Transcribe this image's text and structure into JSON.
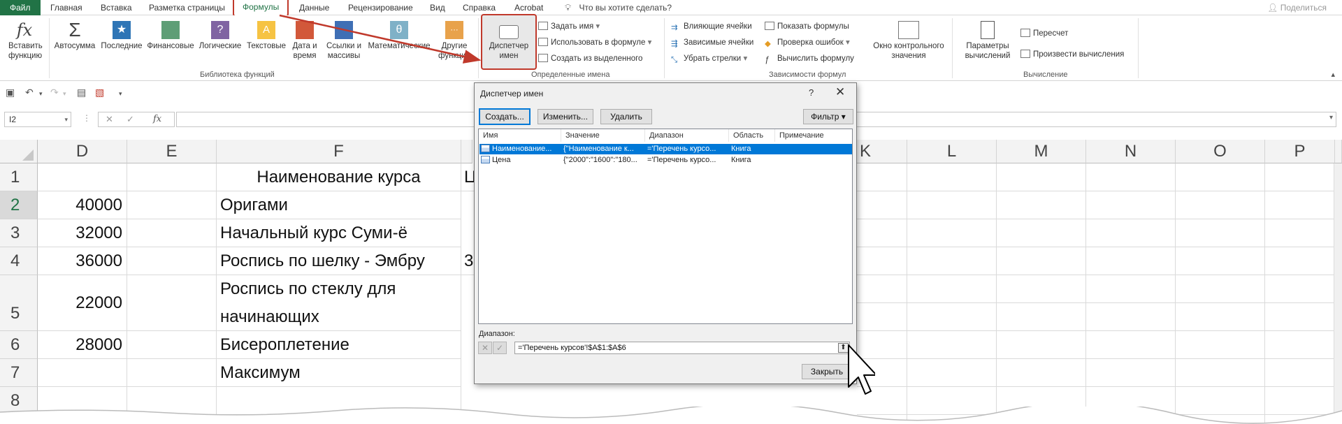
{
  "menu": {
    "tabs": [
      "Файл",
      "Главная",
      "Вставка",
      "Разметка страницы",
      "Формулы",
      "Данные",
      "Рецензирование",
      "Вид",
      "Справка",
      "Acrobat"
    ],
    "search": "Что вы хотите сделать?",
    "share": "Поделиться"
  },
  "ribbon": {
    "insert_function": "Вставить функцию",
    "autosum": "Автосумма",
    "recent": "Последние",
    "financial": "Финансовые",
    "logical": "Логические",
    "text": "Текстовые",
    "datetime": "Дата и время",
    "lookup": "Ссылки и массивы",
    "math": "Математические",
    "other": "Другие функции",
    "group_library": "Библиотека функций",
    "name_manager": "Диспетчер имен",
    "define_name": "Задать имя",
    "use_in_formula": "Использовать в формуле",
    "create_from_selection": "Создать из выделенного",
    "group_names": "Определенные имена",
    "trace_precedents": "Влияющие ячейки",
    "trace_dependents": "Зависимые ячейки",
    "remove_arrows": "Убрать стрелки",
    "show_formulas": "Показать формулы",
    "error_checking": "Проверка ошибок",
    "evaluate_formula": "Вычислить формулу",
    "watch_window": "Окно контрольного значения",
    "group_auditing": "Зависимости формул",
    "calc_options": "Параметры вычислений",
    "calc_now": "Пересчет",
    "calc_sheet": "Произвести вычисления",
    "group_calc": "Вычисление"
  },
  "formula_bar": {
    "name_box": "I2",
    "fx": "fx"
  },
  "grid": {
    "columns": [
      "D",
      "E",
      "F",
      "K",
      "L",
      "M",
      "N",
      "O",
      "P"
    ],
    "rows": [
      "1",
      "2",
      "3",
      "4",
      "5",
      "6",
      "7",
      "8"
    ],
    "f_header": "Наименование курса",
    "partial_g1": "Ц",
    "partial_g4": "3",
    "d_values": [
      "",
      "40000",
      "32000",
      "36000",
      "22000",
      "28000",
      "",
      ""
    ],
    "f_values": [
      "",
      "Оригами",
      "Начальный курс Суми-ё",
      "Роспись по шелку - Эмбру",
      "Роспись по стеклу для",
      "Бисероплетение",
      "Максимум",
      ""
    ],
    "f5_line2": "начинающих"
  },
  "dialog": {
    "title": "Диспетчер имен",
    "help": "?",
    "close": "✕",
    "btn_create": "Создать...",
    "btn_edit": "Изменить...",
    "btn_delete": "Удалить",
    "btn_filter": "Фильтр ▾",
    "headers": [
      "Имя",
      "Значение",
      "Диапазон",
      "Область",
      "Примечание"
    ],
    "rows": [
      {
        "name": "Наименование...",
        "value": "{\"Наименование к...",
        "range": "='Перечень курсо...",
        "scope": "Книга",
        "note": ""
      },
      {
        "name": "Цена",
        "value": "{\"2000\":\"1600\":\"180...",
        "range": "='Перечень курсо...",
        "scope": "Книга",
        "note": ""
      }
    ],
    "range_label": "Диапазон:",
    "range_value": "='Перечень курсов'!$A$1:$A$6",
    "btn_close": "Закрыть"
  }
}
